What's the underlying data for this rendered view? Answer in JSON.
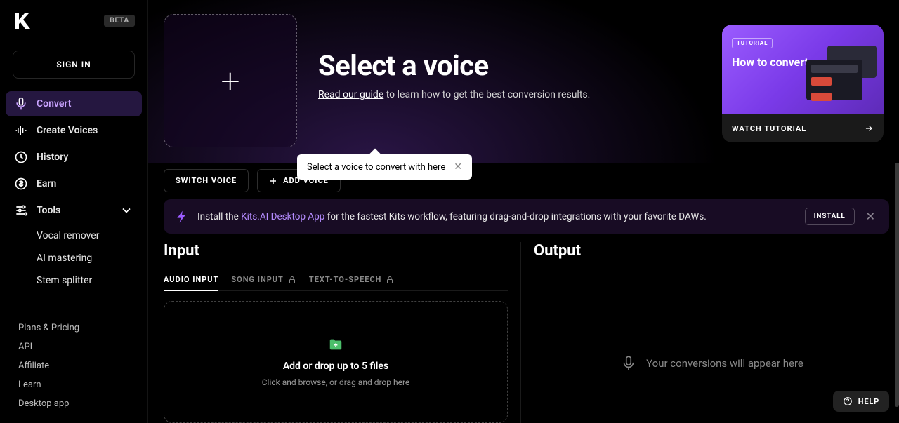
{
  "header": {
    "beta": "BETA",
    "signin": "SIGN IN"
  },
  "nav": {
    "convert": "Convert",
    "create_voices": "Create Voices",
    "history": "History",
    "earn": "Earn",
    "tools": "Tools",
    "tools_sub": {
      "vocal_remover": "Vocal remover",
      "ai_mastering": "AI mastering",
      "stem_splitter": "Stem splitter"
    }
  },
  "footer_links": {
    "plans": "Plans & Pricing",
    "api": "API",
    "affiliate": "Affiliate",
    "learn": "Learn",
    "desktop": "Desktop app"
  },
  "hero": {
    "title": "Select a voice",
    "guide_link": "Read our guide",
    "guide_rest": " to learn how to get the best conversion results."
  },
  "tutorial": {
    "badge": "TUTORIAL",
    "title": "How to convert a voice",
    "watch": "WATCH TUTORIAL"
  },
  "tooltip": "Select a voice to convert with here",
  "voice_actions": {
    "switch": "SWITCH VOICE",
    "add": "ADD VOICE"
  },
  "banner": {
    "pre": "Install the ",
    "link": "Kits.AI Desktop App",
    "post": " for the fastest Kits workflow, featuring drag-and-drop integrations with your favorite DAWs.",
    "install": "INSTALL"
  },
  "io": {
    "input_title": "Input",
    "output_title": "Output",
    "tabs": {
      "audio": "AUDIO INPUT",
      "song": "SONG INPUT",
      "tts": "TEXT-TO-SPEECH"
    },
    "drop_title": "Add or drop up to 5 files",
    "drop_sub": "Click and browse, or drag and drop here",
    "output_empty": "Your conversions will appear here"
  },
  "help": "HELP"
}
